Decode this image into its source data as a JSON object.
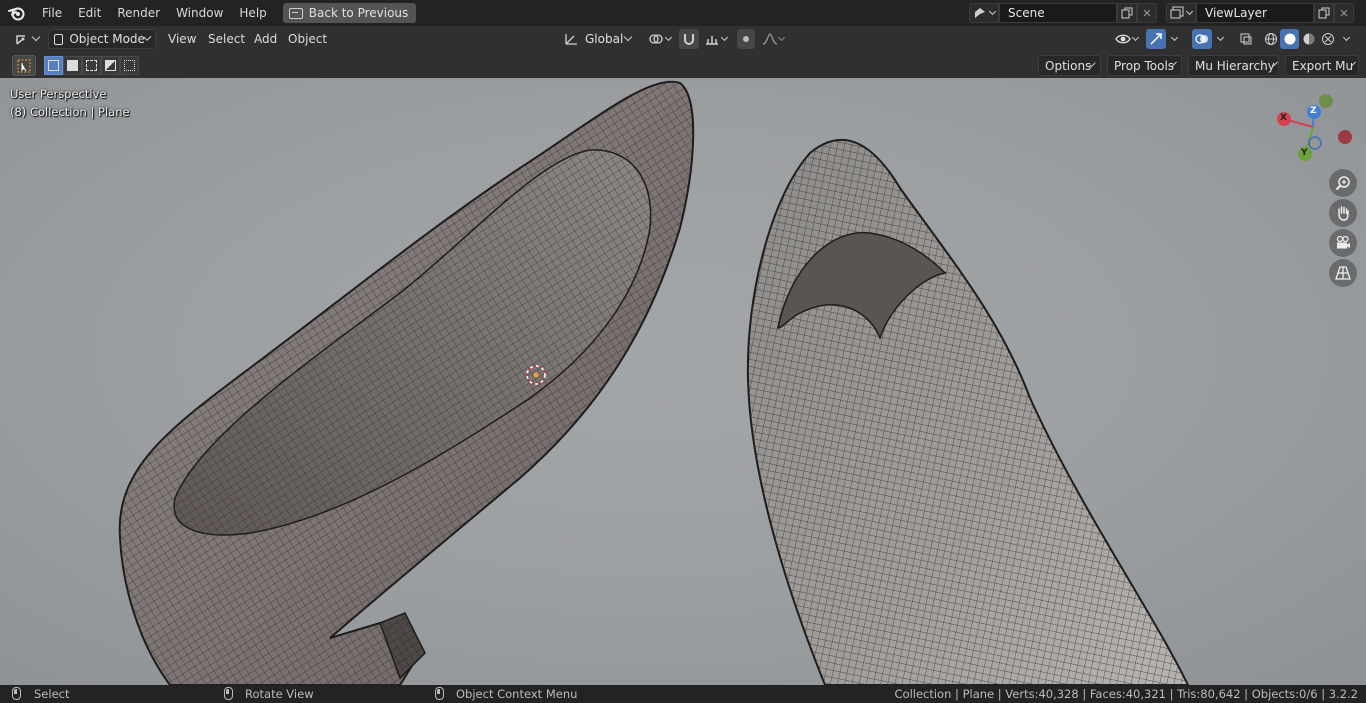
{
  "topbar": {
    "menu": [
      "File",
      "Edit",
      "Render",
      "Window",
      "Help"
    ],
    "back_button": "Back to Previous",
    "scene_name": "Scene",
    "view_layer_name": "ViewLayer"
  },
  "header": {
    "mode": "Object Mode",
    "menus": [
      "View",
      "Select",
      "Add",
      "Object"
    ],
    "transform_orientation": "Global"
  },
  "tool_header": {
    "options": "Options",
    "prop_tools": "Prop Tools",
    "mu_hierarchy": "Mu Hierarchy",
    "export_mu": "Export Mu"
  },
  "viewport": {
    "perspective": "User Perspective",
    "context": "(8) Collection | Plane",
    "gizmo_axes": {
      "x": "X",
      "y": "Y",
      "z": "Z"
    },
    "colors": {
      "x_axis": "#d5424f",
      "y_axis": "#6aa33a",
      "z_axis": "#3f7fd6"
    }
  },
  "status": {
    "select": "Select",
    "rotate": "Rotate View",
    "context_menu": "Object Context Menu",
    "stats": "Collection | Plane | Verts:40,328 | Faces:40,321 | Tris:80,642 | Objects:0/6 | 3.2.2"
  }
}
